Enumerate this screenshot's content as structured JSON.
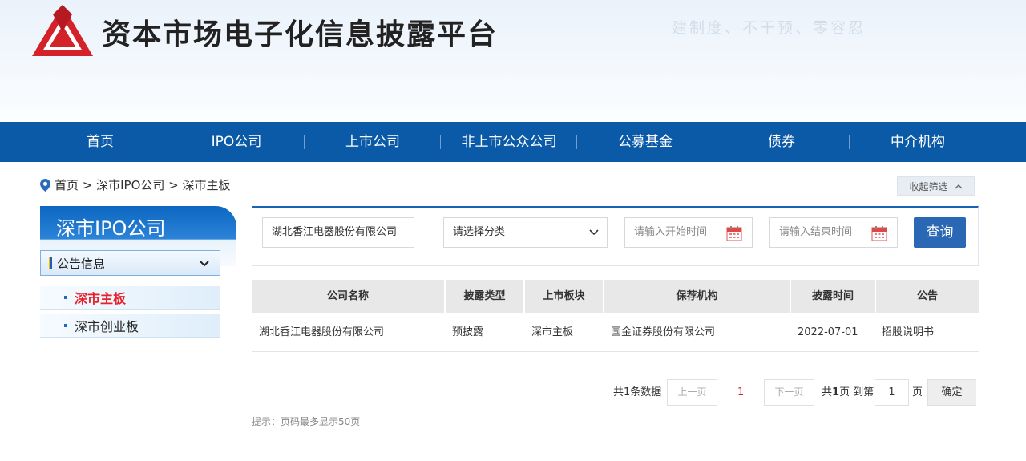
{
  "header": {
    "title": "资本市场电子化信息披露平台",
    "slogan": "建制度、不干预、零容忍"
  },
  "nav": {
    "items": [
      "首页",
      "IPO公司",
      "上市公司",
      "非上市公众公司",
      "公募基金",
      "债券",
      "中介机构"
    ]
  },
  "breadcrumb": {
    "text": "首页 > 深市IPO公司 > 深市主板"
  },
  "collapse": {
    "label": "收起筛选"
  },
  "sidebar": {
    "title": "深市IPO公司",
    "group_label": "公告信息",
    "items": [
      {
        "label": "深市主板",
        "active": true
      },
      {
        "label": "深市创业板",
        "active": false
      }
    ]
  },
  "filter": {
    "company_value": "湖北香江电器股份有限公司",
    "category_value": "请选择分类",
    "start_placeholder": "请输入开始时间",
    "end_placeholder": "请输入结束时间",
    "query_label": "查询"
  },
  "table": {
    "headers": [
      "公司名称",
      "披露类型",
      "上市板块",
      "保荐机构",
      "披露时间",
      "公告"
    ],
    "rows": [
      [
        "湖北香江电器股份有限公司",
        "预披露",
        "深市主板",
        "国金证券股份有限公司",
        "2022-07-01",
        "招股说明书"
      ]
    ]
  },
  "pagination": {
    "total_text": "共1条数据",
    "prev_label": "上一页",
    "current_page": "1",
    "next_label": "下一页",
    "pages_prefix": "共",
    "pages_count": "1",
    "pages_suffix": "页 到第",
    "goto_value": "1",
    "page_unit": "页",
    "confirm_label": "确定"
  },
  "tip": "提示：页码最多显示50页",
  "colors": {
    "nav_blue": "#0b5aa8",
    "query_blue": "#2a68b5",
    "active_red": "#e8202a",
    "logo_red": "#d3222a"
  }
}
